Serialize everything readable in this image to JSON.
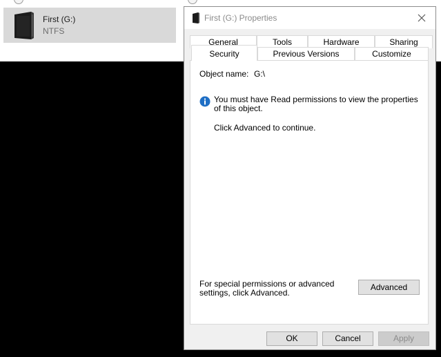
{
  "explorer": {
    "drive_name": "First (G:)",
    "drive_filesystem": "NTFS",
    "drive_icon": "external-drive-icon"
  },
  "dialog": {
    "title": "First (G:) Properties",
    "title_icon": "drive-icon",
    "close_icon": "close-icon",
    "tabs_row1": [
      "General",
      "Tools",
      "Hardware",
      "Sharing"
    ],
    "tabs_row2": [
      "Security",
      "Previous Versions",
      "Customize"
    ],
    "selected_tab": "Security",
    "object_name_label": "Object name:",
    "object_name_value": "G:\\",
    "info_icon": "info-icon",
    "info_message": "You must have Read permissions to view the properties of this object.",
    "advanced_note": "Click Advanced to continue.",
    "special_permissions_text": "For special permissions or advanced settings, click Advanced.",
    "advanced_button": "Advanced",
    "ok_button": "OK",
    "cancel_button": "Cancel",
    "apply_button": "Apply"
  },
  "colors": {
    "accent_info": "#1f6fc5",
    "dialog_bg": "#f0f0f0",
    "panel_bg": "#ffffff",
    "backdrop": "#000000"
  }
}
